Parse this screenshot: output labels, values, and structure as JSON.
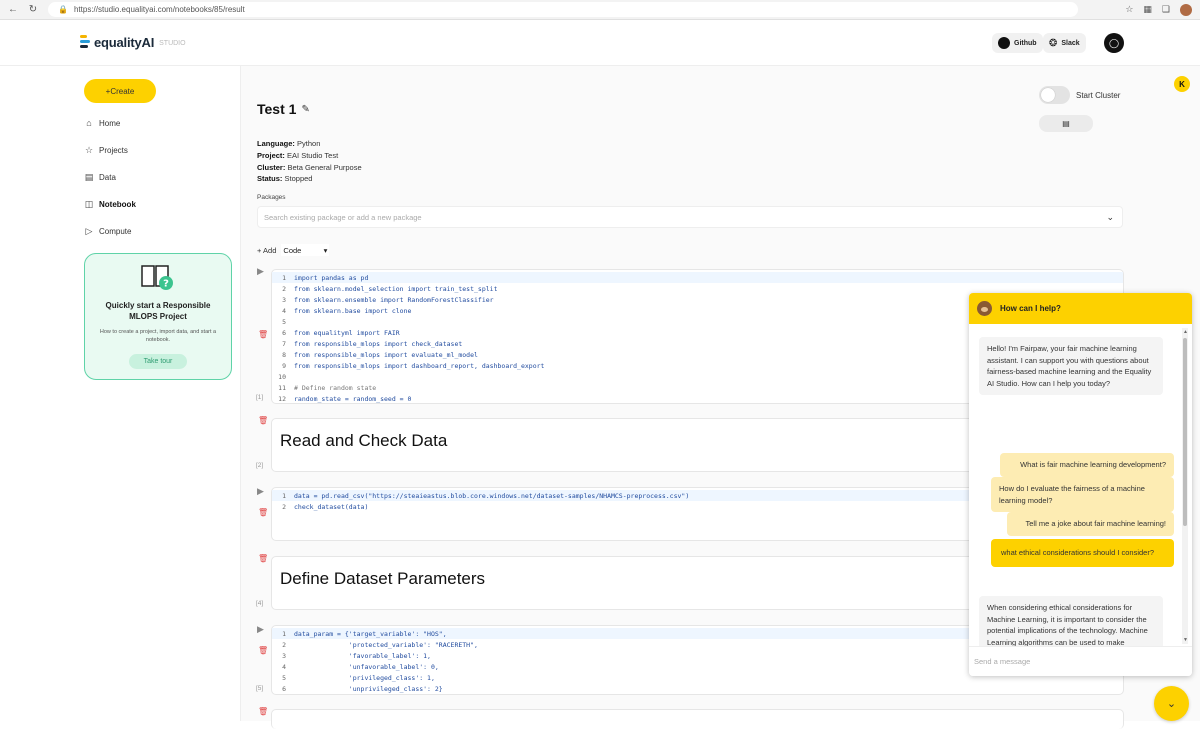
{
  "browser": {
    "url": "https://studio.equalityai.com/notebooks/85/result",
    "icons": [
      "back-icon",
      "refresh-icon",
      "lock-icon",
      "extensions-icon"
    ]
  },
  "header": {
    "logo_text": "equalityAI",
    "logo_sub": "STUDIO",
    "github_label": "Github",
    "slack_label": "Slack"
  },
  "sidebar": {
    "create_label": "+Create",
    "items": [
      {
        "label": "Home",
        "icon": "home-icon"
      },
      {
        "label": "Projects",
        "icon": "star-icon"
      },
      {
        "label": "Data",
        "icon": "document-icon"
      },
      {
        "label": "Notebook",
        "icon": "book-icon",
        "active": true
      },
      {
        "label": "Compute",
        "icon": "play-icon"
      }
    ],
    "tour": {
      "title": "Quickly start a Responsible MLOPS Project",
      "description": "How to create a project, import data, and start a notebook.",
      "button": "Take tour"
    }
  },
  "notebook": {
    "title": "Test 1",
    "language_label": "Language:",
    "language": "Python",
    "project_label": "Project:",
    "project": "EAI Studio Test",
    "cluster_label": "Cluster:",
    "cluster": "Beta General Purpose",
    "status_label": "Status:",
    "status": "Stopped",
    "start_cluster_label": "Start Cluster",
    "packages_label": "Packages",
    "packages_placeholder": "Search existing package or add a new package",
    "add_label": "+ Add",
    "cell_type": "Code"
  },
  "cells": {
    "c1": {
      "number": "[1]",
      "lines": [
        "import pandas as pd",
        "from sklearn.model_selection import train_test_split",
        "from sklearn.ensemble import RandomForestClassifier",
        "from sklearn.base import clone",
        "",
        "from equalityml import FAIR",
        "from responsible_mlops import check_dataset",
        "from responsible_mlops import evaluate_ml_model",
        "from responsible_mlops import dashboard_report, dashboard_export",
        "",
        "# Define random state",
        "random_state = random_seed = 0"
      ]
    },
    "c2": {
      "number": "[2]",
      "text": "Read and Check Data"
    },
    "c3": {
      "number": "",
      "lines": [
        "data = pd.read_csv(\"https://steaieastus.blob.core.windows.net/dataset-samples/NHAMCS-preprocess.csv\")",
        "check_dataset(data)"
      ]
    },
    "c4": {
      "number": "[4]",
      "text": "Define Dataset Parameters"
    },
    "c5": {
      "number": "[5]",
      "lines": [
        "data_param = {'target_variable': \"HOS\",",
        "              'protected_variable': \"RACERETH\",",
        "              'favorable_label': 1,",
        "              'unfavorable_label': 0,",
        "              'privileged_class': 1,",
        "              'unprivileged_class': 2}"
      ]
    }
  },
  "chat": {
    "header": "How can I help?",
    "messages": [
      {
        "role": "bot",
        "text": "Hello! I'm Fairpaw, your fair machine learning assistant. I can support you with questions about fairness-based machine learning and the Equality AI Studio. How can I help you today?"
      },
      {
        "role": "user",
        "text": "What is fair machine learning development?"
      },
      {
        "role": "user",
        "text": "How do I evaluate the fairness of a machine learning model?"
      },
      {
        "role": "user",
        "text": "Tell me a joke about fair machine learning!"
      },
      {
        "role": "user",
        "text": "what ethical considerations should I consider?"
      },
      {
        "role": "bot",
        "text": "When considering ethical considerations for Machine Learning, it is important to consider the potential implications of the technology. Machine Learning algorithms can be used to make decisions that have a direct impact on people's lives, so it is important to ensure that they do not lead"
      }
    ],
    "input_placeholder": "Send a message",
    "badge": "K"
  }
}
